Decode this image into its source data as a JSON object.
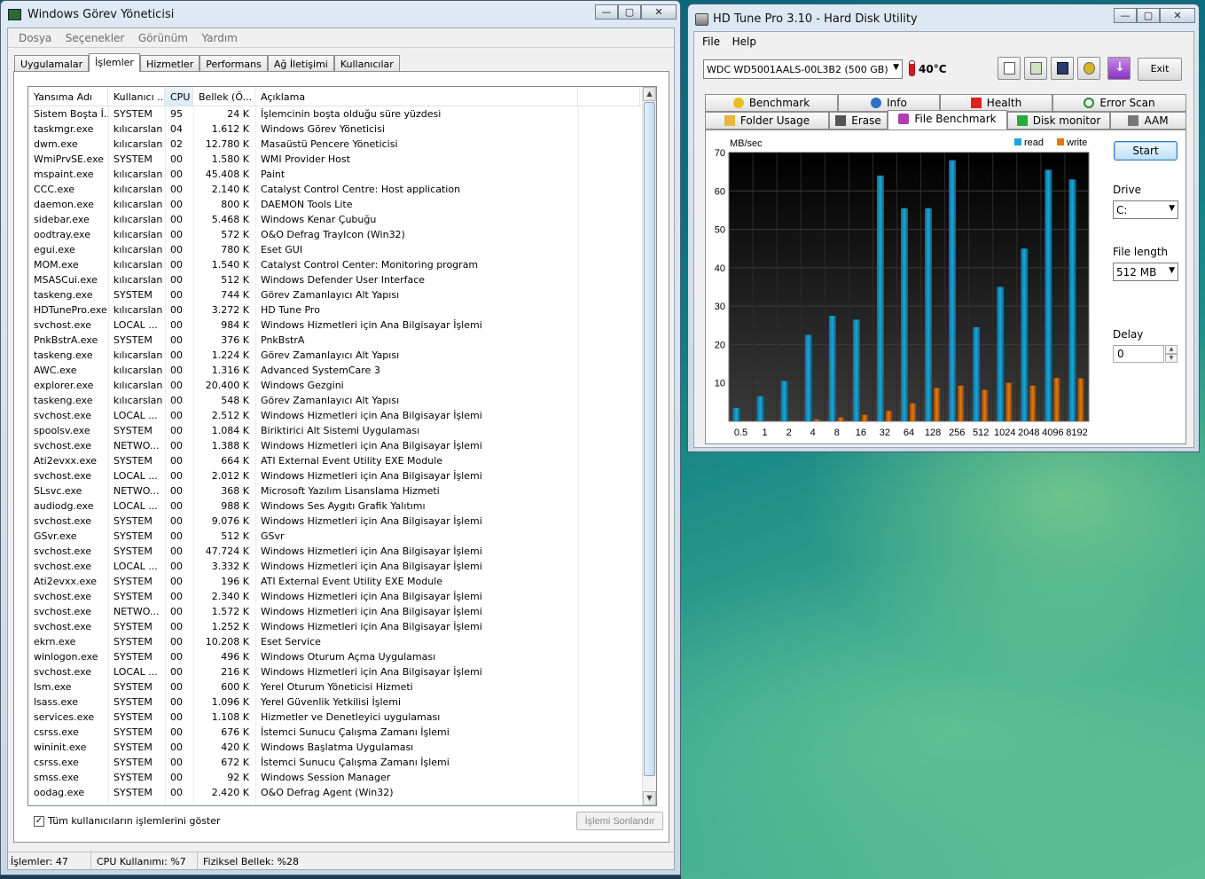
{
  "task_manager": {
    "title": "Windows Görev Yöneticisi",
    "menu": [
      "Dosya",
      "Seçenekler",
      "Görünüm",
      "Yardım"
    ],
    "tabs": [
      "Uygulamalar",
      "İşlemler",
      "Hizmetler",
      "Performans",
      "Ağ İletişimi",
      "Kullanıcılar"
    ],
    "active_tab": "İşlemler",
    "columns": [
      "Yansıma Adı",
      "Kullanıcı ...",
      "CPU",
      "Bellek (Ö...",
      "Açıklama"
    ],
    "sorted_column": "CPU",
    "rows": [
      [
        "Sistem Boşta İ...",
        "SYSTEM",
        "95",
        "24 K",
        "İşlemcinin boşta olduğu süre yüzdesi"
      ],
      [
        "taskmgr.exe",
        "kılıcarslan",
        "04",
        "1.612 K",
        "Windows Görev Yöneticisi"
      ],
      [
        "dwm.exe",
        "kılıcarslan",
        "02",
        "12.780 K",
        "Masaüstü Pencere Yöneticisi"
      ],
      [
        "WmiPrvSE.exe",
        "SYSTEM",
        "00",
        "1.580 K",
        "WMI Provider Host"
      ],
      [
        "mspaint.exe",
        "kılıcarslan",
        "00",
        "45.408 K",
        "Paint"
      ],
      [
        "CCC.exe",
        "kılıcarslan",
        "00",
        "2.140 K",
        "Catalyst Control Centre: Host application"
      ],
      [
        "daemon.exe",
        "kılıcarslan",
        "00",
        "800 K",
        "DAEMON Tools Lite"
      ],
      [
        "sidebar.exe",
        "kılıcarslan",
        "00",
        "5.468 K",
        "Windows Kenar Çubuğu"
      ],
      [
        "oodtray.exe",
        "kılıcarslan",
        "00",
        "572 K",
        "O&O Defrag TrayIcon (Win32)"
      ],
      [
        "egui.exe",
        "kılıcarslan",
        "00",
        "780 K",
        "Eset GUI"
      ],
      [
        "MOM.exe",
        "kılıcarslan",
        "00",
        "1.540 K",
        "Catalyst Control Center: Monitoring program"
      ],
      [
        "MSASCui.exe",
        "kılıcarslan",
        "00",
        "512 K",
        "Windows Defender User Interface"
      ],
      [
        "taskeng.exe",
        "SYSTEM",
        "00",
        "744 K",
        "Görev Zamanlayıcı Alt Yapısı"
      ],
      [
        "HDTunePro.exe",
        "kılıcarslan",
        "00",
        "3.272 K",
        "HD Tune Pro"
      ],
      [
        "svchost.exe",
        "LOCAL ...",
        "00",
        "984 K",
        "Windows Hizmetleri için Ana Bilgisayar İşlemi"
      ],
      [
        "PnkBstrA.exe",
        "SYSTEM",
        "00",
        "376 K",
        "PnkBstrA"
      ],
      [
        "taskeng.exe",
        "kılıcarslan",
        "00",
        "1.224 K",
        "Görev Zamanlayıcı Alt Yapısı"
      ],
      [
        "AWC.exe",
        "kılıcarslan",
        "00",
        "1.316 K",
        "Advanced SystemCare 3"
      ],
      [
        "explorer.exe",
        "kılıcarslan",
        "00",
        "20.400 K",
        "Windows Gezgini"
      ],
      [
        "taskeng.exe",
        "kılıcarslan",
        "00",
        "548 K",
        "Görev Zamanlayıcı Alt Yapısı"
      ],
      [
        "svchost.exe",
        "LOCAL ...",
        "00",
        "2.512 K",
        "Windows Hizmetleri için Ana Bilgisayar İşlemi"
      ],
      [
        "spoolsv.exe",
        "SYSTEM",
        "00",
        "1.084 K",
        "Biriktirici Alt Sistemi Uygulaması"
      ],
      [
        "svchost.exe",
        "NETWO...",
        "00",
        "1.388 K",
        "Windows Hizmetleri için Ana Bilgisayar İşlemi"
      ],
      [
        "Ati2evxx.exe",
        "SYSTEM",
        "00",
        "664 K",
        "ATI External Event Utility EXE Module"
      ],
      [
        "svchost.exe",
        "LOCAL ...",
        "00",
        "2.012 K",
        "Windows Hizmetleri için Ana Bilgisayar İşlemi"
      ],
      [
        "SLsvc.exe",
        "NETWO...",
        "00",
        "368 K",
        "Microsoft Yazılım Lisanslama Hizmeti"
      ],
      [
        "audiodg.exe",
        "LOCAL ...",
        "00",
        "988 K",
        "Windows Ses Aygıtı Grafik Yalıtımı"
      ],
      [
        "svchost.exe",
        "SYSTEM",
        "00",
        "9.076 K",
        "Windows Hizmetleri için Ana Bilgisayar İşlemi"
      ],
      [
        "GSvr.exe",
        "SYSTEM",
        "00",
        "512 K",
        "GSvr"
      ],
      [
        "svchost.exe",
        "SYSTEM",
        "00",
        "47.724 K",
        "Windows Hizmetleri için Ana Bilgisayar İşlemi"
      ],
      [
        "svchost.exe",
        "LOCAL ...",
        "00",
        "3.332 K",
        "Windows Hizmetleri için Ana Bilgisayar İşlemi"
      ],
      [
        "Ati2evxx.exe",
        "SYSTEM",
        "00",
        "196 K",
        "ATI External Event Utility EXE Module"
      ],
      [
        "svchost.exe",
        "SYSTEM",
        "00",
        "2.340 K",
        "Windows Hizmetleri için Ana Bilgisayar İşlemi"
      ],
      [
        "svchost.exe",
        "NETWO...",
        "00",
        "1.572 K",
        "Windows Hizmetleri için Ana Bilgisayar İşlemi"
      ],
      [
        "svchost.exe",
        "SYSTEM",
        "00",
        "1.252 K",
        "Windows Hizmetleri için Ana Bilgisayar İşlemi"
      ],
      [
        "ekrn.exe",
        "SYSTEM",
        "00",
        "10.208 K",
        "Eset Service"
      ],
      [
        "winlogon.exe",
        "SYSTEM",
        "00",
        "496 K",
        "Windows Oturum Açma Uygulaması"
      ],
      [
        "svchost.exe",
        "LOCAL ...",
        "00",
        "216 K",
        "Windows Hizmetleri için Ana Bilgisayar İşlemi"
      ],
      [
        "lsm.exe",
        "SYSTEM",
        "00",
        "600 K",
        "Yerel Oturum Yöneticisi Hizmeti"
      ],
      [
        "lsass.exe",
        "SYSTEM",
        "00",
        "1.096 K",
        "Yerel Güvenlik Yetkilisi İşlemi"
      ],
      [
        "services.exe",
        "SYSTEM",
        "00",
        "1.108 K",
        "Hizmetler ve Denetleyici uygulaması"
      ],
      [
        "csrss.exe",
        "SYSTEM",
        "00",
        "676 K",
        "İstemci Sunucu Çalışma Zamanı İşlemi"
      ],
      [
        "wininit.exe",
        "SYSTEM",
        "00",
        "420 K",
        "Windows Başlatma Uygulaması"
      ],
      [
        "csrss.exe",
        "SYSTEM",
        "00",
        "672 K",
        "İstemci Sunucu Çalışma Zamanı İşlemi"
      ],
      [
        "smss.exe",
        "SYSTEM",
        "00",
        "92 K",
        "Windows Session Manager"
      ],
      [
        "oodag.exe",
        "SYSTEM",
        "00",
        "2.420 K",
        "O&O Defrag Agent (Win32)"
      ]
    ],
    "show_all_users_label": "Tüm kullanıcıların işlemlerini göster",
    "show_all_users_checked": true,
    "end_process_label": "İşlemi Sonlandır",
    "status": {
      "processes": "İşlemler: 47",
      "cpu": "CPU Kullanımı: %7",
      "memory": "Fiziksel Bellek: %28"
    }
  },
  "hdtune": {
    "title": "HD Tune Pro 3.10 - Hard Disk Utility",
    "menu": [
      "File",
      "Help"
    ],
    "drive": "WDC WD5001AALS-00L3B2 (500 GB)",
    "temperature": "40°C",
    "exit_label": "Exit",
    "tabs_row1": [
      "Benchmark",
      "Info",
      "Health",
      "Error Scan"
    ],
    "tabs_row2": [
      "Folder Usage",
      "Erase",
      "File Benchmark",
      "Disk monitor",
      "AAM"
    ],
    "active_tab": "File Benchmark",
    "start_label": "Start",
    "drive_label": "Drive",
    "drive_value": "C:",
    "file_length_label": "File length",
    "file_length_value": "512 MB",
    "delay_label": "Delay",
    "delay_value": "0",
    "colors": {
      "read": "#1aa6d6",
      "write": "#e07a10",
      "plot_bg": "#000000"
    }
  },
  "chart_data": {
    "type": "bar",
    "ylabel": "MB/sec",
    "ylim": [
      0,
      70
    ],
    "yticks": [
      10,
      20,
      30,
      40,
      50,
      60,
      70
    ],
    "categories": [
      "0.5",
      "1",
      "2",
      "4",
      "8",
      "16",
      "32",
      "64",
      "128",
      "256",
      "512",
      "1024",
      "2048",
      "4096",
      "8192"
    ],
    "series": [
      {
        "name": "read",
        "values": [
          3.5,
          6.5,
          10.5,
          22.5,
          27.5,
          26.5,
          64,
          55.5,
          55.5,
          68,
          24.5,
          35,
          45,
          65.5,
          63
        ]
      },
      {
        "name": "write",
        "values": [
          0,
          0,
          0,
          0.5,
          1,
          1.7,
          2.7,
          4.7,
          8.7,
          9.3,
          8.2,
          10,
          9.3,
          11.3,
          11.2
        ]
      }
    ],
    "legend": "top-right",
    "grid": true
  }
}
